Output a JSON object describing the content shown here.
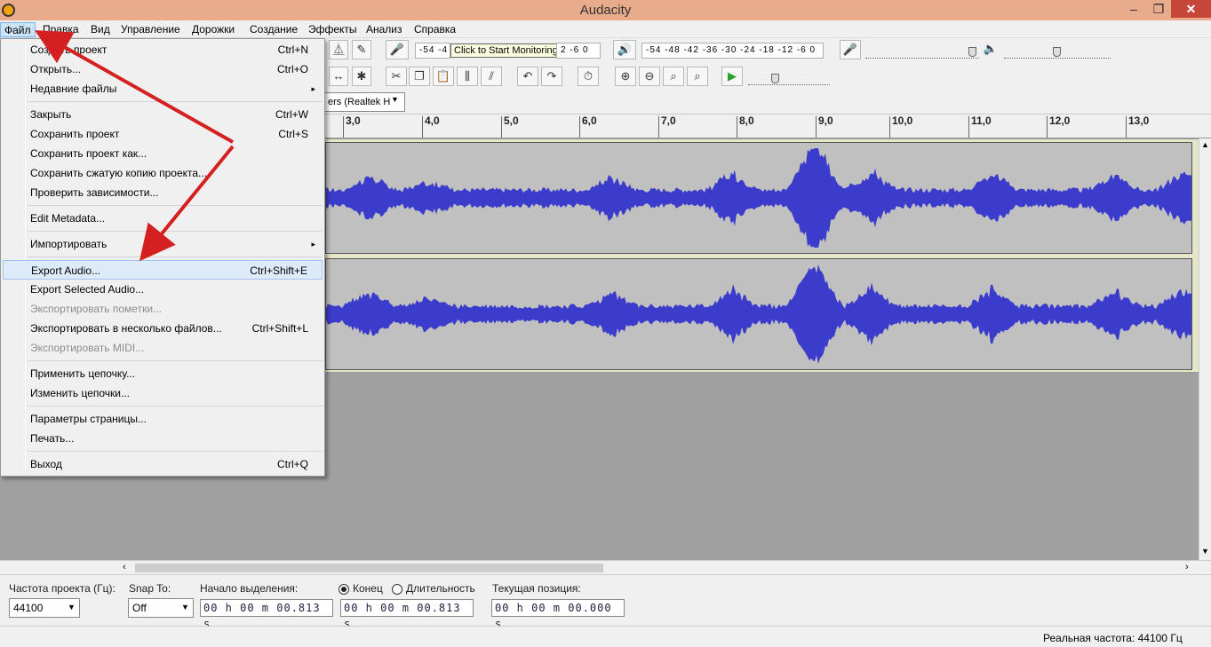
{
  "window": {
    "title": "Audacity",
    "minimize": "–",
    "maximize": "❐",
    "close": "✕"
  },
  "menubar": [
    "Файл",
    "Правка",
    "Вид",
    "Управление",
    "Дорожки",
    "Создание",
    "Эффекты",
    "Анализ",
    "Справка"
  ],
  "file_menu": {
    "items": [
      {
        "label": "Создать проект",
        "shortcut": "Ctrl+N"
      },
      {
        "label": "Открыть...",
        "shortcut": "Ctrl+O"
      },
      {
        "label": "Недавние файлы",
        "submenu": "▸"
      },
      {
        "label": "Закрыть",
        "shortcut": "Ctrl+W"
      },
      {
        "label": "Сохранить проект",
        "shortcut": "Ctrl+S"
      },
      {
        "label": "Сохранить проект как..."
      },
      {
        "label": "Сохранить сжатую копию проекта..."
      },
      {
        "label": "Проверить зависимости..."
      },
      {
        "label": "Edit Metadata..."
      },
      {
        "label": "Импортировать",
        "submenu": "▸"
      },
      {
        "label": "Export Audio...",
        "shortcut": "Ctrl+Shift+E"
      },
      {
        "label": "Export Selected Audio..."
      },
      {
        "label": "Экспортировать пометки..."
      },
      {
        "label": "Экспортировать в несколько файлов...",
        "shortcut": "Ctrl+Shift+L"
      },
      {
        "label": "Экспортировать MIDI..."
      },
      {
        "label": "Применить цепочку..."
      },
      {
        "label": "Изменить цепочки..."
      },
      {
        "label": "Параметры страницы..."
      },
      {
        "label": "Печать..."
      },
      {
        "label": "Выход",
        "shortcut": "Ctrl+Q"
      }
    ]
  },
  "toolbar": {
    "record_meter_text": "-54 -4",
    "monitor_tooltip": "Click to Start Monitoring",
    "record_meter_tail": "2  -6  0",
    "play_meter_text": "-54 -48 -42 -36 -30 -24 -18 -12  -6  0",
    "device": "ers (Realtek H"
  },
  "ruler": {
    "ticks": [
      "3,0",
      "4,0",
      "5,0",
      "6,0",
      "7,0",
      "8,0",
      "9,0",
      "10,0",
      "11,0",
      "12,0",
      "13,0"
    ]
  },
  "selection_bar": {
    "rate_label": "Частота проекта (Гц):",
    "rate_value": "44100",
    "snap_label": "Snap To:",
    "snap_value": "Off",
    "start_label": "Начало выделения:",
    "start_value": "00 h 00 m 00.813 s",
    "end_label": "Конец",
    "length_label": "Длительность",
    "end_value": "00 h 00 m 00.813 s",
    "pos_label": "Текущая позиция:",
    "pos_value": "00 h 00 m 00.000 s"
  },
  "status": {
    "actual_rate": "Реальная частота: 44100 Гц"
  },
  "colors": {
    "waveform": "#3c3ccc",
    "arrow": "#d42020",
    "titlebar": "#e8ab8c",
    "highlight": "#dceaf9"
  }
}
